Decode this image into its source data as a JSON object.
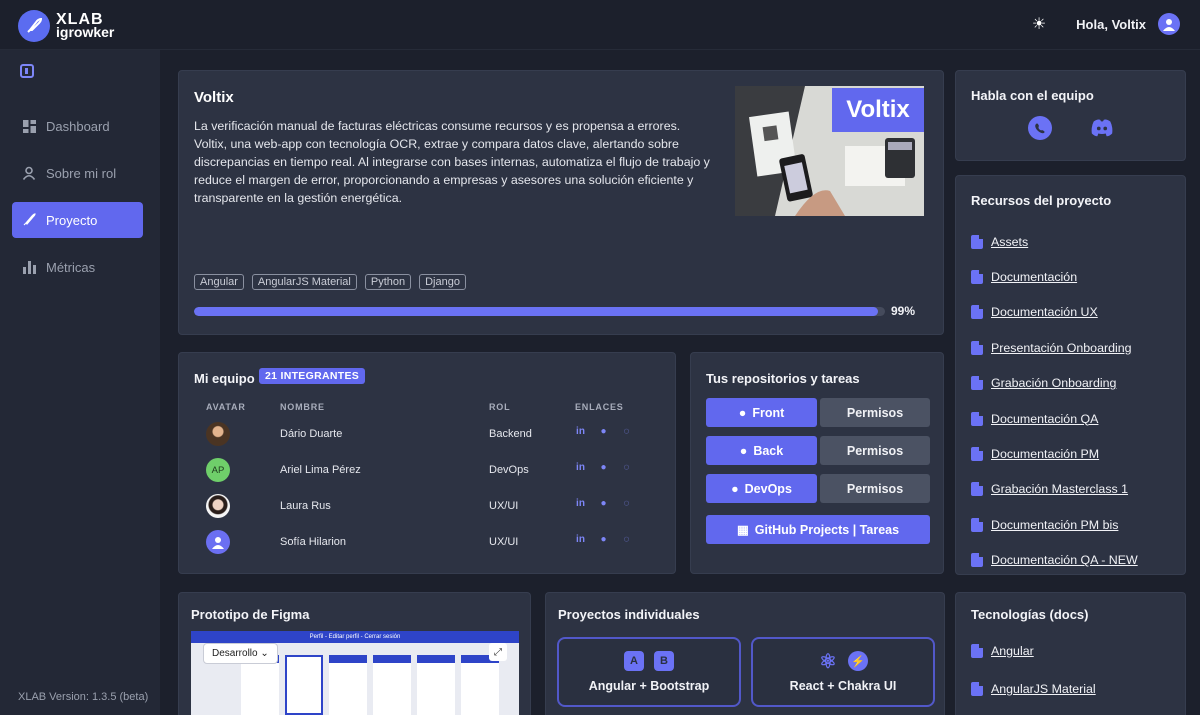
{
  "app": {
    "logo_line1": "XLAB",
    "logo_line2": "igrowker",
    "greeting": "Hola, Voltix",
    "version": "XLAB Version: 1.3.5 (beta)"
  },
  "sidebar": {
    "items": [
      {
        "label": "Dashboard",
        "icon": "dashboard-icon",
        "active": false
      },
      {
        "label": "Sobre mi rol",
        "icon": "user-icon",
        "active": false
      },
      {
        "label": "Proyecto",
        "icon": "rocket-icon",
        "active": true
      },
      {
        "label": "Métricas",
        "icon": "bar-chart-icon",
        "active": false
      }
    ]
  },
  "project": {
    "title": "Voltix",
    "description": "La verificación manual de facturas eléctricas consume recursos y es propensa a errores. Voltix, una web-app con tecnología OCR, extrae y compara datos clave, alertando sobre discrepancias en tiempo real. Al integrarse con bases internas, automatiza el flujo de trabajo y reduce el margen de error, proporcionando a empresas y asesores una solución eficiente y transparente en la gestión energética.",
    "image_label": "Voltix",
    "tags": [
      "Angular",
      "AngularJS Material",
      "Python",
      "Django"
    ],
    "progress_fraction": 0.99,
    "progress_label": "99%"
  },
  "team": {
    "title": "Mi equipo",
    "badge": "21 INTEGRANTES",
    "headers": {
      "avatar": "AVATAR",
      "name": "NOMBRE",
      "role": "ROL",
      "links": "ENLACES"
    },
    "members": [
      {
        "name": "Dário Duarte",
        "role": "Backend",
        "initials": ""
      },
      {
        "name": "Ariel Lima Pérez",
        "role": "DevOps",
        "initials": "AP"
      },
      {
        "name": "Laura Rus",
        "role": "UX/UI",
        "initials": ""
      },
      {
        "name": "Sofía Hilarion",
        "role": "UX/UI",
        "initials": ""
      }
    ]
  },
  "repos": {
    "title": "Tus repositorios y tareas",
    "front": "Front",
    "back": "Back",
    "devops": "DevOps",
    "permissions": "Permisos",
    "projects": "GitHub Projects | Tareas"
  },
  "talk": {
    "title": "Habla con el equipo"
  },
  "resources": {
    "title": "Recursos del proyecto",
    "items": [
      "Assets",
      "Documentación",
      "Documentación UX",
      "Presentación Onboarding",
      "Grabación Onboarding",
      "Documentación QA",
      "Documentación PM",
      "Grabación Masterclass 1",
      "Documentación PM bis",
      "Documentación QA - NEW"
    ]
  },
  "figma": {
    "title": "Prototipo de Figma",
    "dropdown": "Desarrollo",
    "frame_header": "Perfil - Editar perfil - Cerrar sesión"
  },
  "individual": {
    "title": "Proyectos individuales",
    "items": [
      {
        "label": "Angular + Bootstrap",
        "icons": [
          "A",
          "B"
        ]
      },
      {
        "label": "React + Chakra UI",
        "icons": [
          "⚛",
          "⚡"
        ]
      }
    ]
  },
  "tech": {
    "title": "Tecnologías (docs)",
    "items": [
      "Angular",
      "AngularJS Material"
    ]
  }
}
